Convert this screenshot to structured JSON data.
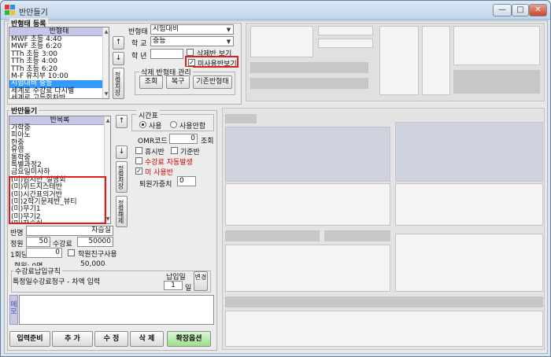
{
  "window": {
    "title": "반만들기",
    "minimize": "—",
    "maximize": "□",
    "close": "✕"
  },
  "class_register": {
    "legend": "반형태 등록",
    "list_header": "반형태",
    "items": [
      "MWF 초등 4:40",
      "MWF 초등 6:20",
      "TTh 초등 3:00",
      "TTh 초등 4:00",
      "TTh 초등 6:20",
      "M-F 유치부 10:00",
      "시험대비 중등",
      "세계로 수강료 다시별",
      "세계로 고등회차반"
    ],
    "selected_index": 6,
    "up_arrow": "↑",
    "down_arrow": "↓",
    "sort_button": "정렬저장",
    "class_type_label": "반형태",
    "class_type_value": "시험대비",
    "school_level_label": "학 교",
    "school_level_value": "중등",
    "grade_label": "학 년",
    "grade_value": "",
    "show_deleted_label": "삭제반 보기",
    "show_unused_label": "미사용반보기",
    "manage_legend": "삭제 반형태 관리",
    "search_btn": "조회",
    "restore_btn": "복구",
    "existing_btn": "기존반형태"
  },
  "class_make": {
    "legend": "반만들기",
    "list_header": "반목록",
    "items": [
      "가학중",
      "피아노",
      "한중",
      "유영",
      "통학중",
      "특별과정2",
      "금요일미사하",
      "(미)임시반_설명회",
      "(미)위드지스테반",
      "(미)시간표의거반",
      "(미)2학기문제반_뷰티",
      "(미)무기1",
      "(미)무기2",
      "(미)자습실"
    ],
    "up_arrow": "↑",
    "down_arrow": "↓",
    "sort_button": "정렬저장",
    "delete_button": "정렬해제",
    "name_label": "반명",
    "name_value": "자습실",
    "quota_label": "정원",
    "quota_value": "50",
    "fee_label": "수강료",
    "fee_value": "50000",
    "once_label": "1회당",
    "once_value": "0",
    "friend_label": "학원친구사용",
    "current_label": "현원: 0명",
    "current_fee": "50,000",
    "tuition_legend": "수강료납입규칙",
    "tuition_text": "특정일수강료청구 - 차액 입력",
    "due_label": "납입일",
    "due_value": "1",
    "due_unit": "일",
    "change_btn": "변경",
    "memo_tab": "메모",
    "memo_value": ""
  },
  "timetable": {
    "legend": "시간표",
    "use_label": "사용",
    "nouse_label": "사용안함",
    "use_selected": true,
    "omr_label": "OMR코드",
    "omr_value": "0",
    "omr_search": "조회",
    "holiday_label": "휴시반",
    "base_label": "기준반",
    "autofee_label": "수강료 자동발생",
    "unused_label": "미 사용반",
    "retire_label": "퇴원가중치",
    "retire_value": "0"
  },
  "bottom_buttons": {
    "ready": "입력준비",
    "add": "추 가",
    "edit": "수 정",
    "delete": "삭 제",
    "expand": "확장옵션"
  },
  "colors": {
    "selection": "#3399ff",
    "highlight_box": "#e21b1b",
    "header_lavender": "#c6c6e6",
    "expand_button": "#bff0b4"
  }
}
